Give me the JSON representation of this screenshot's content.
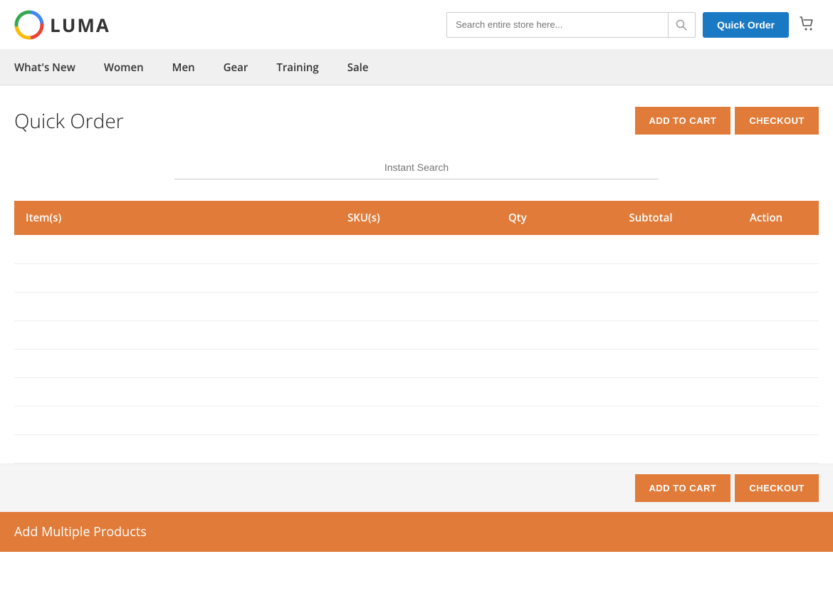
{
  "header": {
    "logo_text": "LUMA",
    "search_placeholder": "Search entire store here...",
    "quick_order_btn": "Quick Order"
  },
  "nav": {
    "items": [
      {
        "label": "What's New",
        "id": "whats-new"
      },
      {
        "label": "Women",
        "id": "women"
      },
      {
        "label": "Men",
        "id": "men"
      },
      {
        "label": "Gear",
        "id": "gear"
      },
      {
        "label": "Training",
        "id": "training"
      },
      {
        "label": "Sale",
        "id": "sale"
      }
    ]
  },
  "main": {
    "page_title": "Quick Order",
    "add_to_cart_label": "ADD TO CART",
    "checkout_label": "CHECKOUT",
    "instant_search_placeholder": "Instant Search",
    "table": {
      "columns": [
        {
          "label": "Item(s)",
          "id": "items"
        },
        {
          "label": "SKU(s)",
          "id": "skus"
        },
        {
          "label": "Qty",
          "id": "qty"
        },
        {
          "label": "Subtotal",
          "id": "subtotal"
        },
        {
          "label": "Action",
          "id": "action"
        }
      ],
      "rows": []
    },
    "add_multiple_label": "Add Multiple Products"
  }
}
